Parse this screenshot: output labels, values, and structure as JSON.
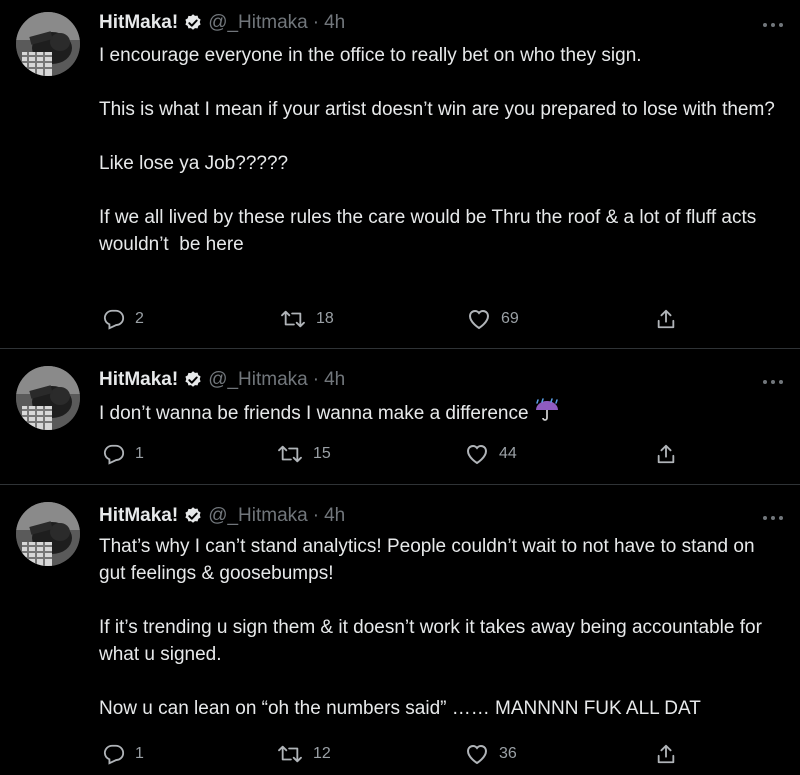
{
  "tweets": [
    {
      "name": "HitMaka!",
      "handle": "@_Hitmaka",
      "separator": "·",
      "time": "4h",
      "paragraphs": [
        "I encourage everyone in the office to really bet on who they sign.",
        "This is what I mean if your artist doesn’t win are you prepared to lose with them?",
        "Like lose ya Job?????",
        "If we all lived by these rules the care would be Thru the roof & a lot of fluff acts wouldn’t  be here"
      ],
      "replies": "2",
      "retweets": "18",
      "likes": "69"
    },
    {
      "name": "HitMaka!",
      "handle": "@_Hitmaka",
      "separator": "·",
      "time": "4h",
      "paragraphs": [
        "I don’t wanna be friends I wanna make a difference"
      ],
      "emoji": "umbrella-with-rain-icon",
      "replies": "1",
      "retweets": "15",
      "likes": "44"
    },
    {
      "name": "HitMaka!",
      "handle": "@_Hitmaka",
      "separator": "·",
      "time": "4h",
      "paragraphs": [
        "That’s why I can’t stand analytics! People couldn’t wait to not have to stand on gut feelings & goosebumps!",
        "If it’s trending u sign them & it doesn’t work it takes away being accountable for what u signed.",
        "Now u can lean on “oh the numbers said” …… MANNNN FUK ALL DAT"
      ],
      "replies": "1",
      "retweets": "12",
      "likes": "36"
    }
  ],
  "colors": {
    "background": "#000000",
    "text": "#e7e9ea",
    "secondary": "#71767b",
    "divider": "#2f3336",
    "verified_badge": "#e7e9ea"
  },
  "icons": {
    "verified": "verified-badge-icon",
    "more": "more-options-icon",
    "reply": "reply-icon",
    "retweet": "retweet-icon",
    "like": "heart-icon",
    "share": "share-icon"
  }
}
